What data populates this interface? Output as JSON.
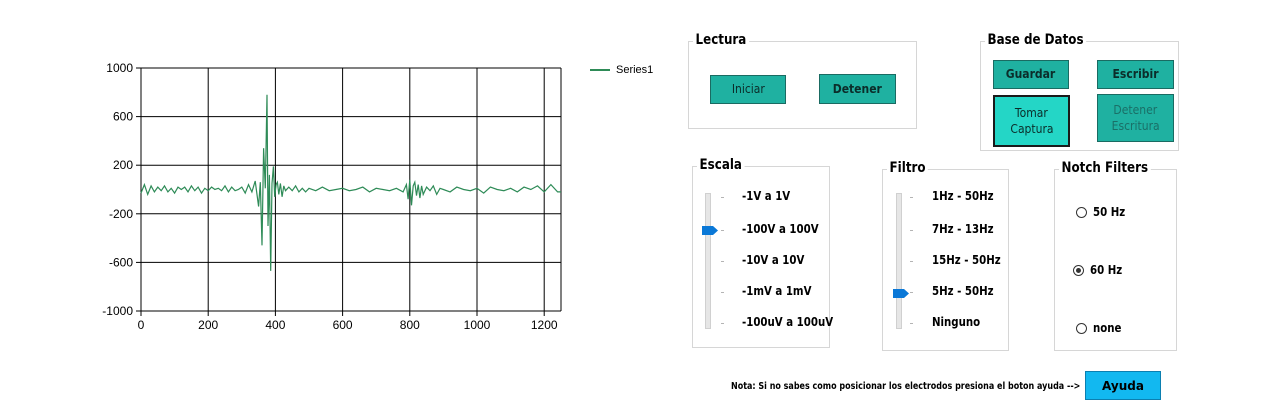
{
  "chart_data": {
    "type": "line",
    "title": "",
    "xlabel": "",
    "ylabel": "",
    "xlim": [
      0,
      1250
    ],
    "ylim": [
      -1000,
      1000
    ],
    "x_ticks": [
      "0",
      "200",
      "400",
      "600",
      "800",
      "1000",
      "1200"
    ],
    "y_ticks": [
      "1000",
      "600",
      "200",
      "-200",
      "-600",
      "-1000"
    ],
    "grid": true,
    "legend_position": "top-right",
    "series": [
      {
        "name": "Series1",
        "color": "#2e8b57",
        "x": [
          0,
          10,
          20,
          30,
          40,
          50,
          60,
          70,
          80,
          90,
          100,
          110,
          120,
          130,
          140,
          150,
          160,
          170,
          180,
          190,
          200,
          210,
          220,
          230,
          240,
          250,
          260,
          270,
          280,
          290,
          300,
          310,
          320,
          330,
          340,
          350,
          355,
          360,
          365,
          370,
          375,
          378,
          382,
          386,
          390,
          394,
          398,
          402,
          406,
          410,
          415,
          420,
          425,
          430,
          440,
          450,
          460,
          470,
          480,
          490,
          500,
          520,
          540,
          560,
          580,
          600,
          620,
          640,
          660,
          680,
          700,
          720,
          740,
          760,
          780,
          790,
          795,
          800,
          805,
          810,
          815,
          820,
          825,
          830,
          835,
          840,
          850,
          860,
          870,
          880,
          890,
          900,
          920,
          940,
          960,
          980,
          1000,
          1020,
          1040,
          1060,
          1080,
          1100,
          1120,
          1140,
          1160,
          1180,
          1200,
          1220,
          1240,
          1250
        ],
        "y": [
          -30,
          40,
          -40,
          30,
          -20,
          20,
          -10,
          30,
          -20,
          10,
          -30,
          20,
          0,
          20,
          -20,
          30,
          -10,
          20,
          -30,
          10,
          -10,
          20,
          0,
          10,
          -10,
          30,
          -20,
          20,
          -10,
          0,
          20,
          -30,
          40,
          -20,
          70,
          -140,
          60,
          -460,
          340,
          10,
          780,
          -300,
          120,
          -670,
          50,
          190,
          -60,
          40,
          60,
          -40,
          50,
          -60,
          30,
          -10,
          20,
          -10,
          30,
          -20,
          10,
          -20,
          10,
          -10,
          20,
          -10,
          0,
          10,
          -10,
          0,
          20,
          -20,
          10,
          0,
          -10,
          10,
          -20,
          40,
          -80,
          80,
          -130,
          30,
          60,
          -50,
          40,
          -70,
          30,
          -40,
          20,
          -10,
          30,
          -40,
          10,
          0,
          -20,
          20,
          0,
          -10,
          10,
          -30,
          20,
          0,
          -10,
          10,
          -20,
          20,
          0,
          30,
          -20,
          40,
          -20,
          -20
        ]
      }
    ]
  },
  "lectura": {
    "title": "Lectura",
    "start_label": "Iniciar",
    "stop_label": "Detener"
  },
  "base_datos": {
    "title": "Base de Datos",
    "save_label": "Guardar",
    "write_label": "Escribir",
    "capture_label_1": "Tomar",
    "capture_label_2": "Captura",
    "stop_write_label_1": "Detener",
    "stop_write_label_2": "Escritura"
  },
  "escala": {
    "title": "Escala",
    "options": [
      "-1V a 1V",
      "-100V a 100V",
      "-10V a 10V",
      "-1mV a 1mV",
      "-100uV a 100uV"
    ],
    "selected": "-100V a 100V"
  },
  "filtro": {
    "title": "Filtro",
    "options": [
      "1Hz - 50Hz",
      "7Hz - 13Hz",
      "15Hz - 50Hz",
      "5Hz - 50Hz",
      "Ninguno"
    ],
    "selected": "5Hz - 50Hz"
  },
  "notch": {
    "title": "Notch Filters",
    "options": [
      "50 Hz",
      "60 Hz",
      "none"
    ],
    "selected": "60 Hz"
  },
  "note": "Nota: Si no sabes como posicionar los electrodos presiona el boton ayuda -->",
  "help_label": "Ayuda",
  "colors": {
    "button_teal": "#1fb1a1",
    "button_focused": "#24d6c6",
    "help_blue": "#12b8f0",
    "slider_thumb": "#0a78d7"
  }
}
